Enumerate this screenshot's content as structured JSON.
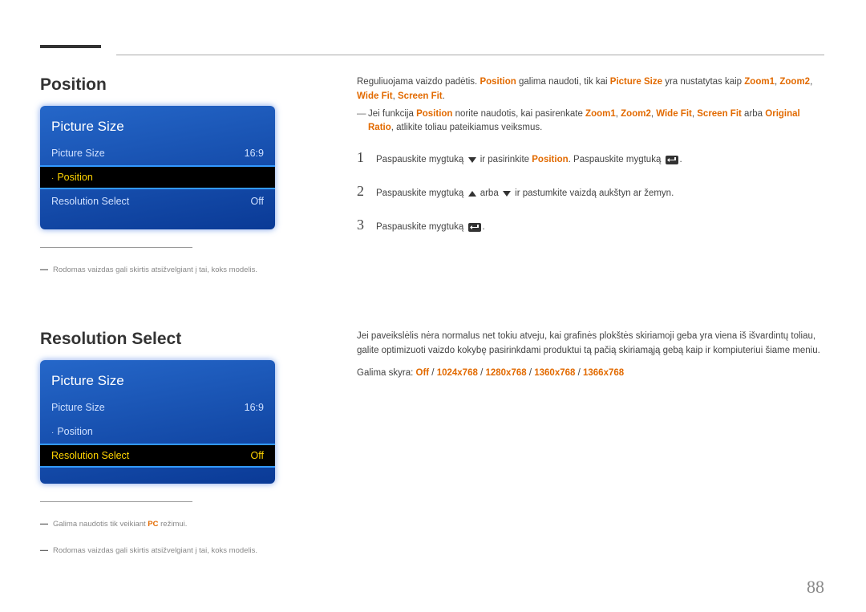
{
  "page_number": "88",
  "section1": {
    "heading": "Position",
    "shot": {
      "title": "Picture Size",
      "rows": [
        {
          "label": "Picture Size",
          "value": "16:9",
          "bullet": false,
          "selected": false
        },
        {
          "label": "Position",
          "value": "",
          "bullet": true,
          "selected": true
        },
        {
          "label": "Resolution Select",
          "value": "Off",
          "bullet": false,
          "selected": false
        }
      ]
    },
    "footnotes": [
      {
        "text": "Rodomas vaizdas gali skirtis atsižvelgiant į tai, koks modelis."
      }
    ],
    "right": {
      "intro_pre": "Reguliuojama vaizdo padėtis. ",
      "intro_hl1": "Position",
      "intro_mid": " galima naudoti, tik kai ",
      "intro_hl2": "Picture Size",
      "intro_mid2": " yra nustatytas kaip ",
      "intro_hl3": "Zoom1",
      "intro_sep1": ", ",
      "intro_hl4": "Zoom2",
      "intro_sep2": ", ",
      "intro_hl5": "Wide Fit",
      "intro_sep3": ", ",
      "intro_hl6": "Screen Fit",
      "intro_end": ".",
      "note_pre": "Jei funkcija ",
      "note_hl1": "Position",
      "note_mid1": " norite naudotis, kai pasirenkate ",
      "note_hl2": "Zoom1",
      "note_sep1": ", ",
      "note_hl3": "Zoom2",
      "note_sep2": ", ",
      "note_hl4": "Wide Fit",
      "note_sep3": ", ",
      "note_hl5": "Screen Fit",
      "note_mid2": " arba ",
      "note_hl6": "Original Ratio",
      "note_end": ", atlikite toliau pateikiamus veiksmus.",
      "steps": {
        "s1": {
          "num": "1",
          "pre": "Paspauskite mygtuką ",
          "mid": " ir pasirinkite ",
          "hl": "Position",
          "post": ". Paspauskite mygtuką ",
          "end": "."
        },
        "s2": {
          "num": "2",
          "pre": "Paspauskite mygtuką ",
          "mid": " arba ",
          "post": " ir pastumkite vaizdą aukštyn ar žemyn."
        },
        "s3": {
          "num": "3",
          "pre": "Paspauskite mygtuką ",
          "end": "."
        }
      }
    }
  },
  "section2": {
    "heading": "Resolution Select",
    "shot": {
      "title": "Picture Size",
      "rows": [
        {
          "label": "Picture Size",
          "value": "16:9",
          "bullet": false,
          "selected": false
        },
        {
          "label": "Position",
          "value": "",
          "bullet": true,
          "selected": false
        },
        {
          "label": "Resolution Select",
          "value": "Off",
          "bullet": false,
          "selected": true
        }
      ]
    },
    "footnotes": [
      {
        "pre": "Galima naudotis tik veikiant ",
        "hl": "PC",
        "post": " režimui."
      },
      {
        "text": "Rodomas vaizdas gali skirtis atsižvelgiant į tai, koks modelis."
      }
    ],
    "right": {
      "para": "Jei paveikslėlis nėra normalus net tokiu atveju, kai grafinės plokštės skiriamoji geba yra viena iš išvardintų toliau, galite optimizuoti vaizdo kokybę pasirinkdami produktui tą pačią skiriamąją gebą kaip ir kompiuteriui šiame meniu.",
      "avail_pre": "Galima skyra: ",
      "avail_hl1": "Off",
      "sep": " / ",
      "avail_hl2": "1024x768",
      "avail_hl3": "1280x768",
      "avail_hl4": "1360x768",
      "avail_hl5": "1366x768"
    }
  }
}
